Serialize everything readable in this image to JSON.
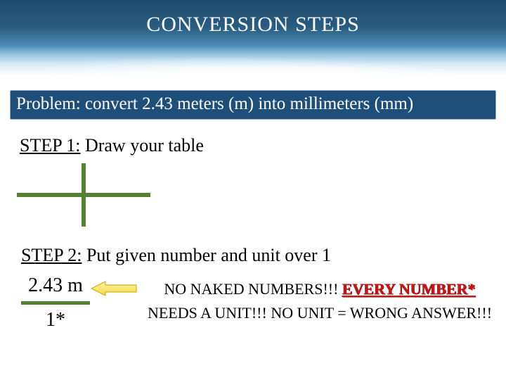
{
  "title": "CONVERSION STEPS",
  "problem": "Problem: convert 2.43 meters (m) into millimeters (mm)",
  "step1": {
    "label": "STEP 1:",
    "text": " Draw your table"
  },
  "step2": {
    "label": "STEP 2:",
    "text": " Put given number and unit over 1"
  },
  "fraction": {
    "numerator": "2.43 m",
    "denominator": "1*"
  },
  "warning": {
    "pre": "NO NAKED NUMBERS!!! ",
    "emph": "EVERY NUMBER*",
    "post": " NEEDS A UNIT!!! NO UNIT = WRONG ANSWER!!!"
  }
}
